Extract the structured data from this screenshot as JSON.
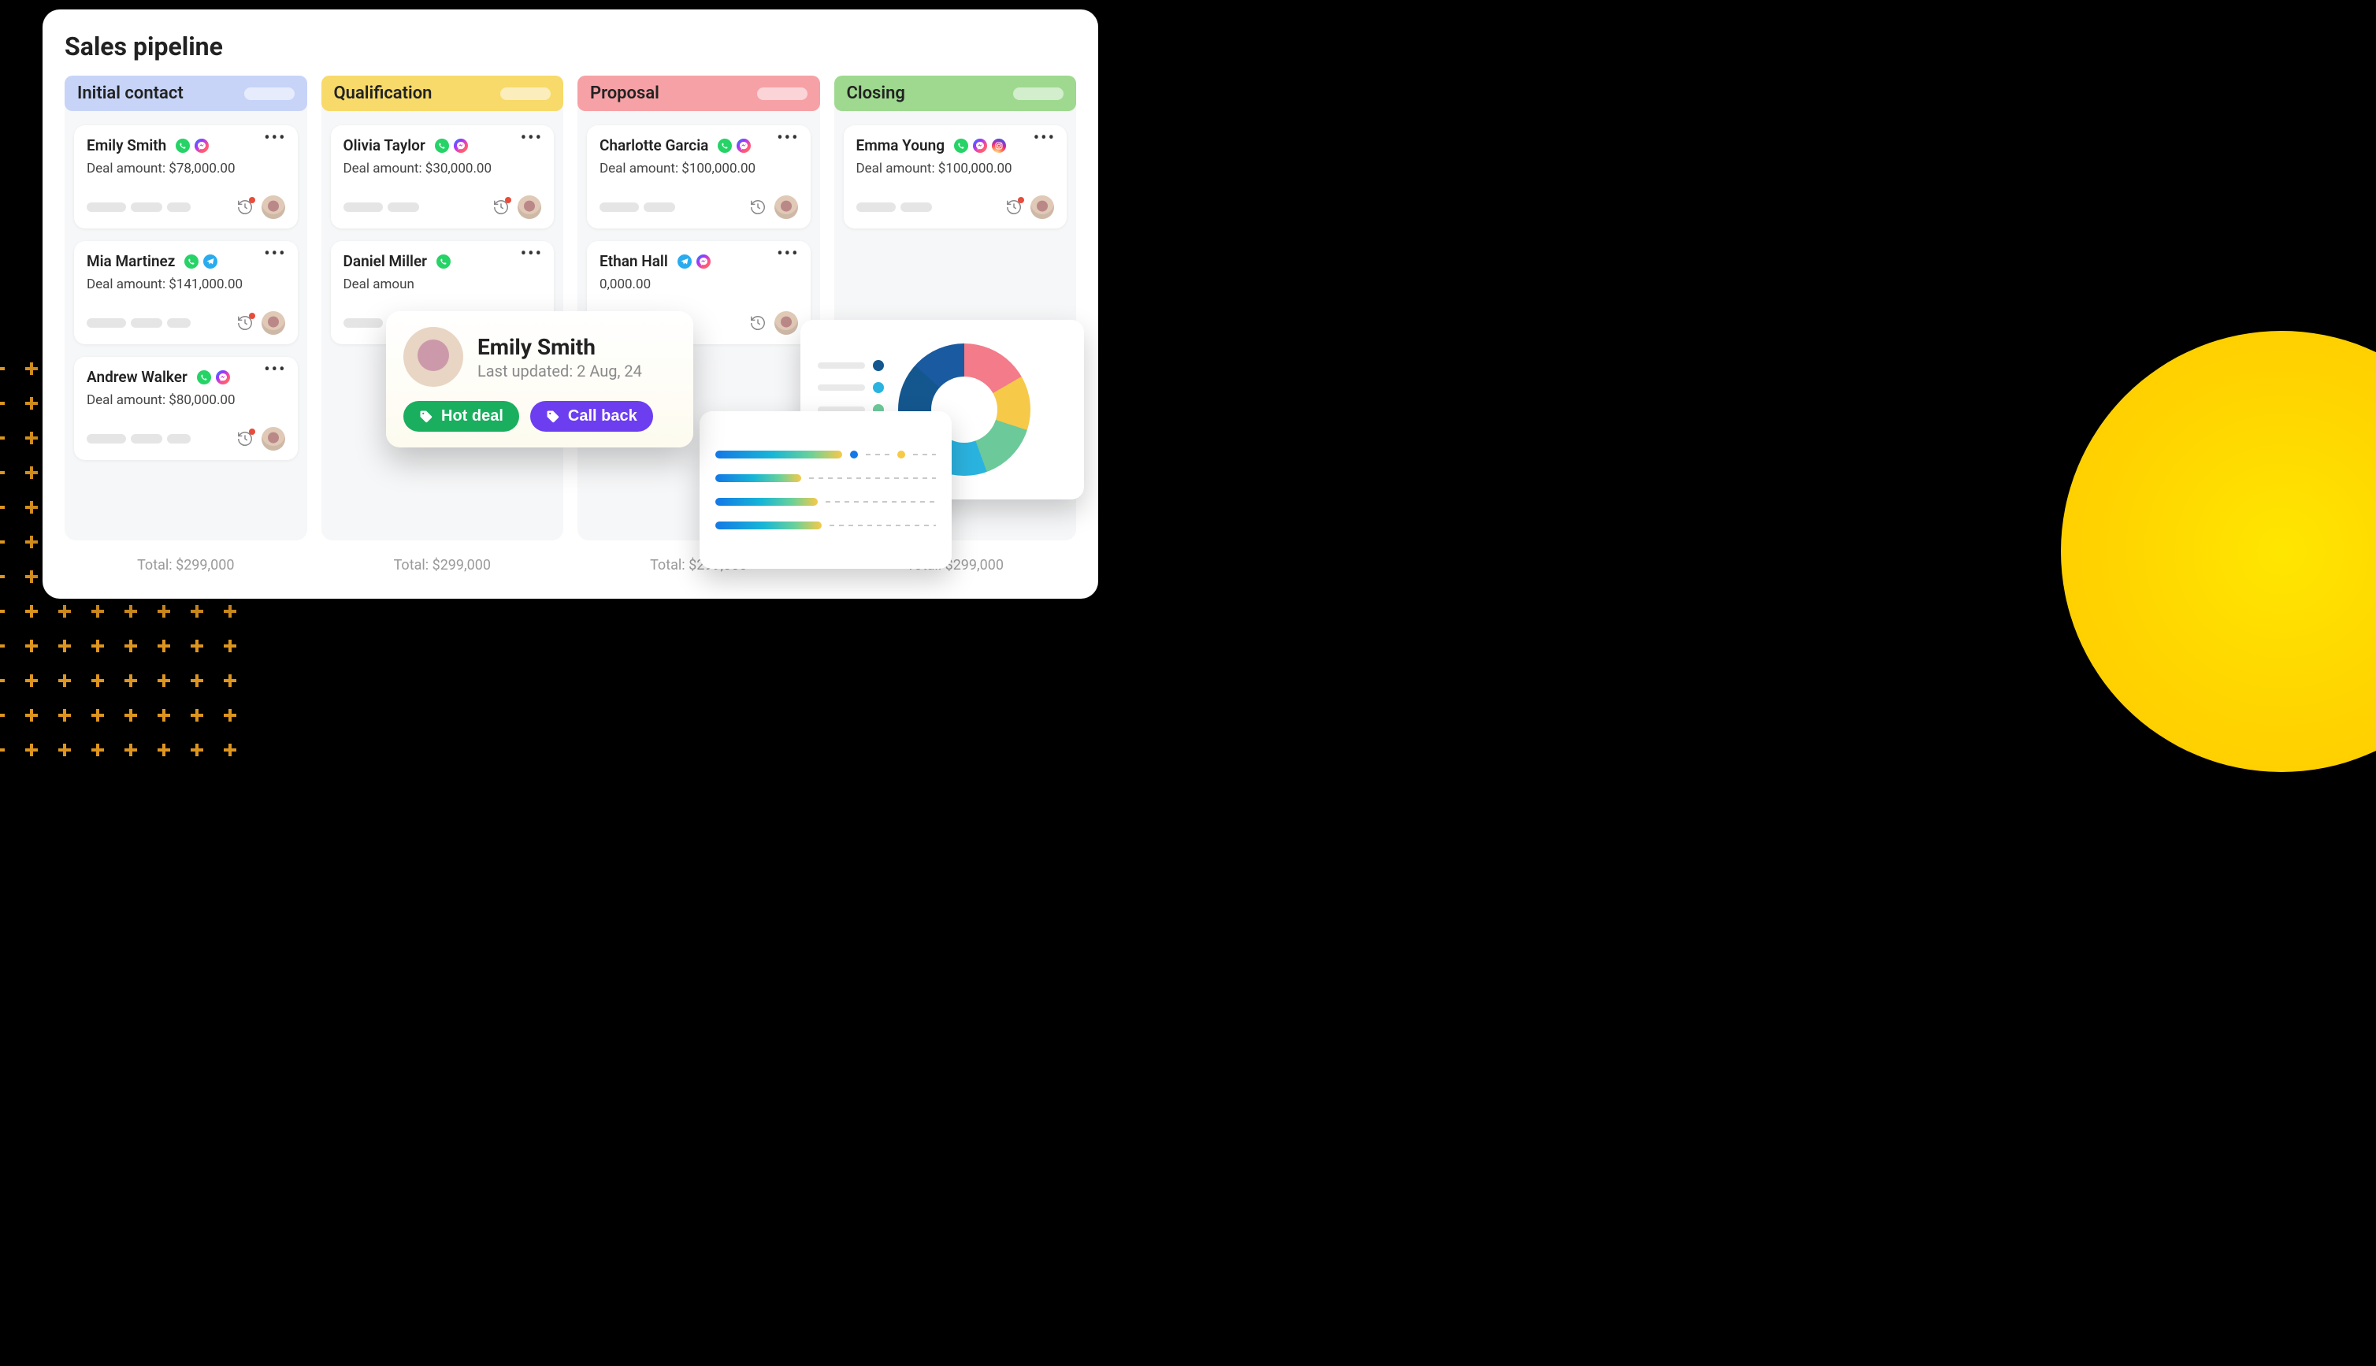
{
  "board": {
    "title": "Sales pipeline",
    "columns": [
      {
        "key": "initial",
        "label": "Initial contact",
        "total_label": "Total: $299,000",
        "cards": [
          {
            "name": "Emily Smith",
            "amount_label": "Deal amount: $78,000.00",
            "channels": [
              "whatsapp",
              "messenger"
            ],
            "has_alert": true
          },
          {
            "name": "Mia Martinez",
            "amount_label": "Deal amount: $141,000.00",
            "channels": [
              "whatsapp",
              "telegram"
            ],
            "has_alert": true
          },
          {
            "name": "Andrew Walker",
            "amount_label": "Deal amount: $80,000.00",
            "channels": [
              "whatsapp",
              "messenger"
            ],
            "has_alert": true
          }
        ]
      },
      {
        "key": "qual",
        "label": "Qualification",
        "total_label": "Total: $299,000",
        "cards": [
          {
            "name": "Olivia Taylor",
            "amount_label": "Deal amount: $30,000.00",
            "channels": [
              "whatsapp",
              "messenger"
            ],
            "has_alert": true
          },
          {
            "name": "Daniel Miller",
            "amount_label_partial": "Deal amoun",
            "channels": [
              "whatsapp"
            ],
            "has_alert": false
          }
        ]
      },
      {
        "key": "proposal",
        "label": "Proposal",
        "total_label": "Total: $299,000",
        "cards": [
          {
            "name": "Charlotte Garcia",
            "amount_label": "Deal amount: $100,000.00",
            "channels": [
              "whatsapp",
              "messenger"
            ],
            "has_alert": false
          },
          {
            "name": "Ethan Hall",
            "amount_label_partial": "0,000.00",
            "channels": [
              "telegram",
              "messenger"
            ],
            "has_alert": false
          }
        ]
      },
      {
        "key": "closing",
        "label": "Closing",
        "total_label": "Total: $299,000",
        "cards": [
          {
            "name": "Emma Young",
            "amount_label": "Deal amount: $100,000.00",
            "channels": [
              "whatsapp",
              "messenger",
              "instagram"
            ],
            "has_alert": true
          }
        ]
      }
    ]
  },
  "popover": {
    "name": "Emily Smith",
    "subtitle": "Last updated: 2 Aug, 24",
    "tags": {
      "hot": "Hot deal",
      "call": "Call back"
    }
  },
  "chart_data": {
    "bars": {
      "type": "bar",
      "title": "",
      "series": [
        {
          "name": "row1",
          "value": 62
        },
        {
          "name": "row2",
          "value": 42
        },
        {
          "name": "row3",
          "value": 50
        },
        {
          "name": "row4",
          "value": 52
        }
      ],
      "range": [
        0,
        100
      ]
    },
    "donut": {
      "type": "pie",
      "title": "",
      "slices": [
        {
          "name": "pink",
          "value": 17,
          "color": "#f37b8a"
        },
        {
          "name": "yellow",
          "value": 13,
          "color": "#f7c948"
        },
        {
          "name": "green",
          "value": 14,
          "color": "#6cc99a"
        },
        {
          "name": "lightblue",
          "value": 20,
          "color": "#2bb3e0"
        },
        {
          "name": "navy",
          "value": 22,
          "color": "#14578f"
        },
        {
          "name": "blue",
          "value": 14,
          "color": "#1a5aa0"
        }
      ]
    }
  },
  "legend_colors": [
    "#14578f",
    "#2bb3e0",
    "#6cc99a",
    "#1478e6",
    "#f7c948"
  ]
}
